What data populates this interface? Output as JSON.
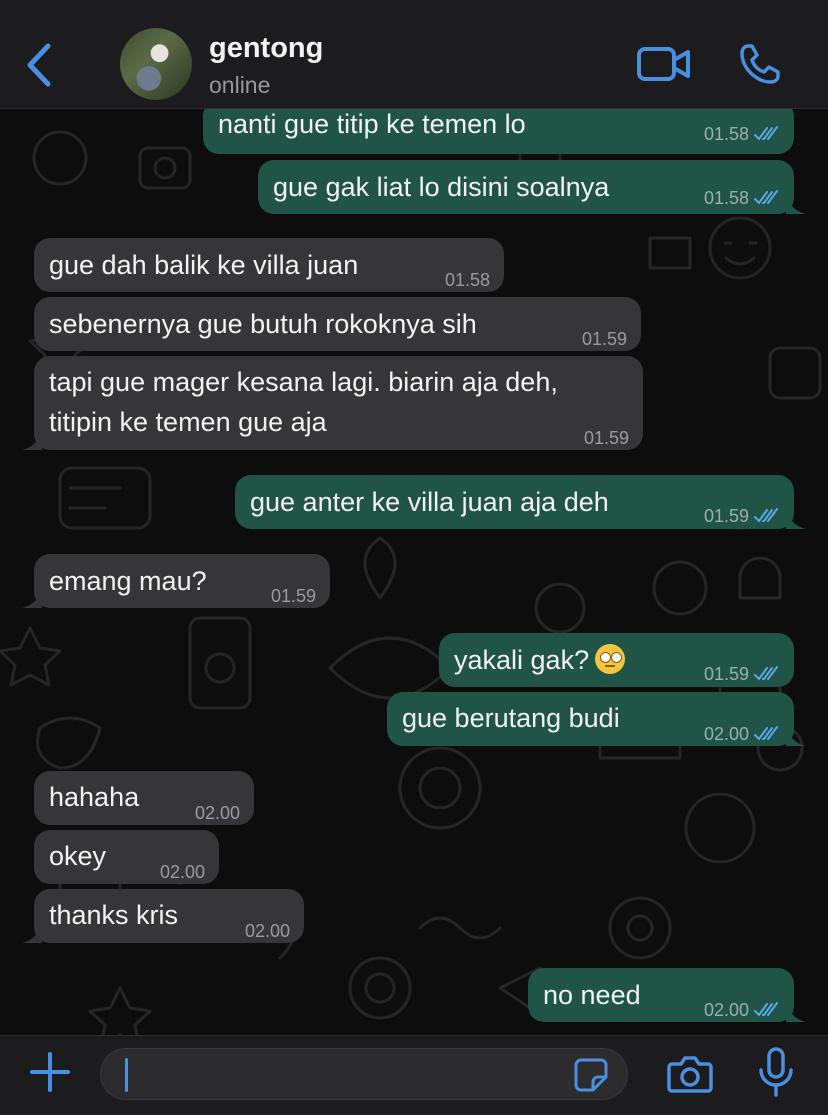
{
  "header": {
    "contact_name": "gentong",
    "status": "online"
  },
  "icons": {
    "back": "chevron-left-icon",
    "video": "video-camera-icon",
    "call": "phone-icon",
    "add": "plus-icon",
    "sticker": "sticker-icon",
    "camera": "camera-icon",
    "mic": "microphone-icon"
  },
  "colors": {
    "accent": "#4a90e2",
    "incoming_bubble": "#363638",
    "outgoing_bubble": "#1f5446",
    "read_ticks": "#5aa9e6"
  },
  "messages": [
    {
      "direction": "out",
      "text": "nanti gue titip ke temen lo",
      "time": "01.58",
      "read": true
    },
    {
      "direction": "out",
      "text": "gue gak liat lo disini soalnya",
      "time": "01.58",
      "read": true
    },
    {
      "direction": "in",
      "text": "gue dah balik ke villa juan",
      "time": "01.58"
    },
    {
      "direction": "in",
      "text": "sebenernya gue butuh rokoknya sih",
      "time": "01.59"
    },
    {
      "direction": "in",
      "line1": "tapi gue mager kesana lagi. biarin aja deh,",
      "line2": "titipin ke temen gue aja",
      "time": "01.59"
    },
    {
      "direction": "out",
      "text": "gue anter ke villa juan aja deh",
      "time": "01.59",
      "read": true
    },
    {
      "direction": "in",
      "text": "emang mau?",
      "time": "01.59"
    },
    {
      "direction": "out",
      "text": "yakali gak?",
      "emoji": "face-with-rolling-eyes",
      "time": "01.59",
      "read": true
    },
    {
      "direction": "out",
      "text": "gue berutang budi",
      "time": "02.00",
      "read": true
    },
    {
      "direction": "in",
      "text": "hahaha",
      "time": "02.00"
    },
    {
      "direction": "in",
      "text": "okey",
      "time": "02.00"
    },
    {
      "direction": "in",
      "text": "thanks kris",
      "time": "02.00"
    },
    {
      "direction": "out",
      "text": "no need",
      "time": "02.00",
      "read": true
    }
  ],
  "composer": {
    "message_value": ""
  }
}
